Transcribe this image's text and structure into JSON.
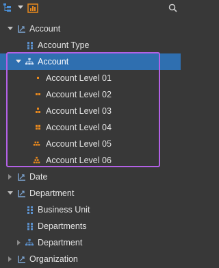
{
  "toolbar": {
    "tree_view_icon": "hierarchy-tree-icon",
    "dropdown_icon": "caret-down-icon",
    "chart_icon": "chart-icon",
    "search_icon": "search-icon"
  },
  "colors": {
    "background": "#383838",
    "selection": "#2f6fb0",
    "highlight_border": "#b361e6",
    "level_icon": "#e8891e",
    "attribute_icon": "#5b8fc9"
  },
  "tree": [
    {
      "label": "Account",
      "icon": "dimension-icon",
      "expanded": true
    },
    {
      "label": "Account Type",
      "icon": "attribute-icon"
    },
    {
      "label": "Account",
      "icon": "hierarchy-icon",
      "expanded": true,
      "selected": true
    },
    {
      "label": "Account Level 01",
      "icon": "level-01-icon"
    },
    {
      "label": "Account Level 02",
      "icon": "level-02-icon"
    },
    {
      "label": "Account Level 03",
      "icon": "level-03-icon"
    },
    {
      "label": "Account Level 04",
      "icon": "level-04-icon"
    },
    {
      "label": "Account Level 05",
      "icon": "level-05-icon"
    },
    {
      "label": "Account Level 06",
      "icon": "level-06-icon"
    },
    {
      "label": "Date",
      "icon": "dimension-icon",
      "expanded": false
    },
    {
      "label": "Department",
      "icon": "dimension-icon",
      "expanded": true
    },
    {
      "label": "Business Unit",
      "icon": "attribute-icon"
    },
    {
      "label": "Departments",
      "icon": "attribute-icon"
    },
    {
      "label": "Department",
      "icon": "hierarchy-icon",
      "expanded": false
    },
    {
      "label": "Organization",
      "icon": "dimension-icon",
      "expanded": false
    }
  ]
}
